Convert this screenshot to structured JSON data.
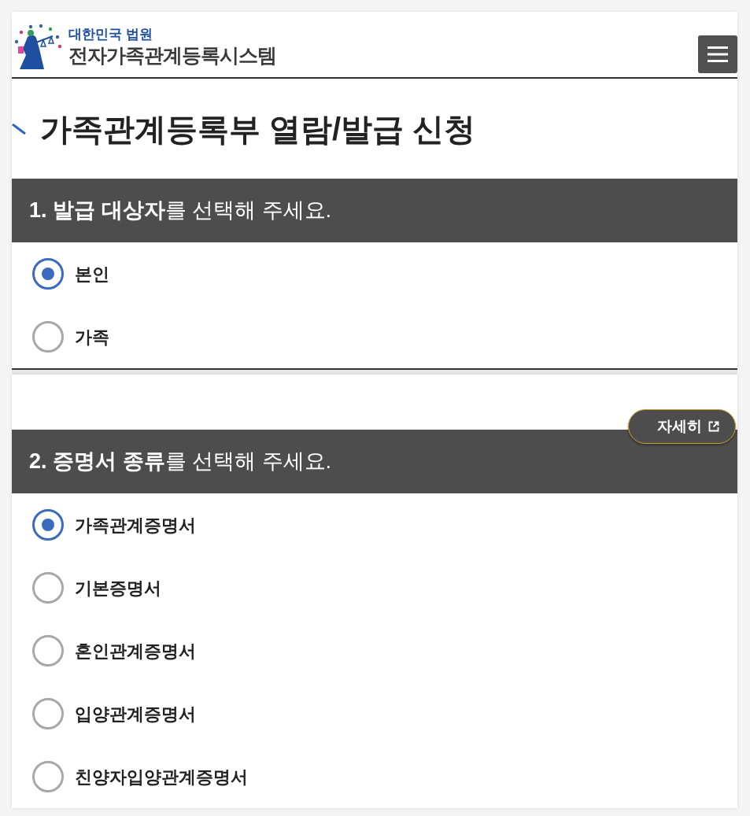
{
  "header": {
    "logo_top": "대한민국 법원",
    "logo_main": "전자가족관계등록시스템"
  },
  "page_title": "가족관계등록부 열람/발급 신청",
  "sections": [
    {
      "heading": "**1. 발급 대상자**를 선택해 주세요.",
      "options": [
        {
          "label": "본인",
          "selected": true
        },
        {
          "label": "가족",
          "selected": false
        }
      ]
    },
    {
      "detail_button": "자세히",
      "heading": "**2. 증명서 종류**를 선택해 주세요.",
      "options": [
        {
          "label": "가족관계증명서",
          "selected": true
        },
        {
          "label": "기본증명서",
          "selected": false
        },
        {
          "label": "혼인관계증명서",
          "selected": false
        },
        {
          "label": "입양관계증명서",
          "selected": false
        },
        {
          "label": "친양자입양관계증명서",
          "selected": false
        }
      ]
    }
  ]
}
